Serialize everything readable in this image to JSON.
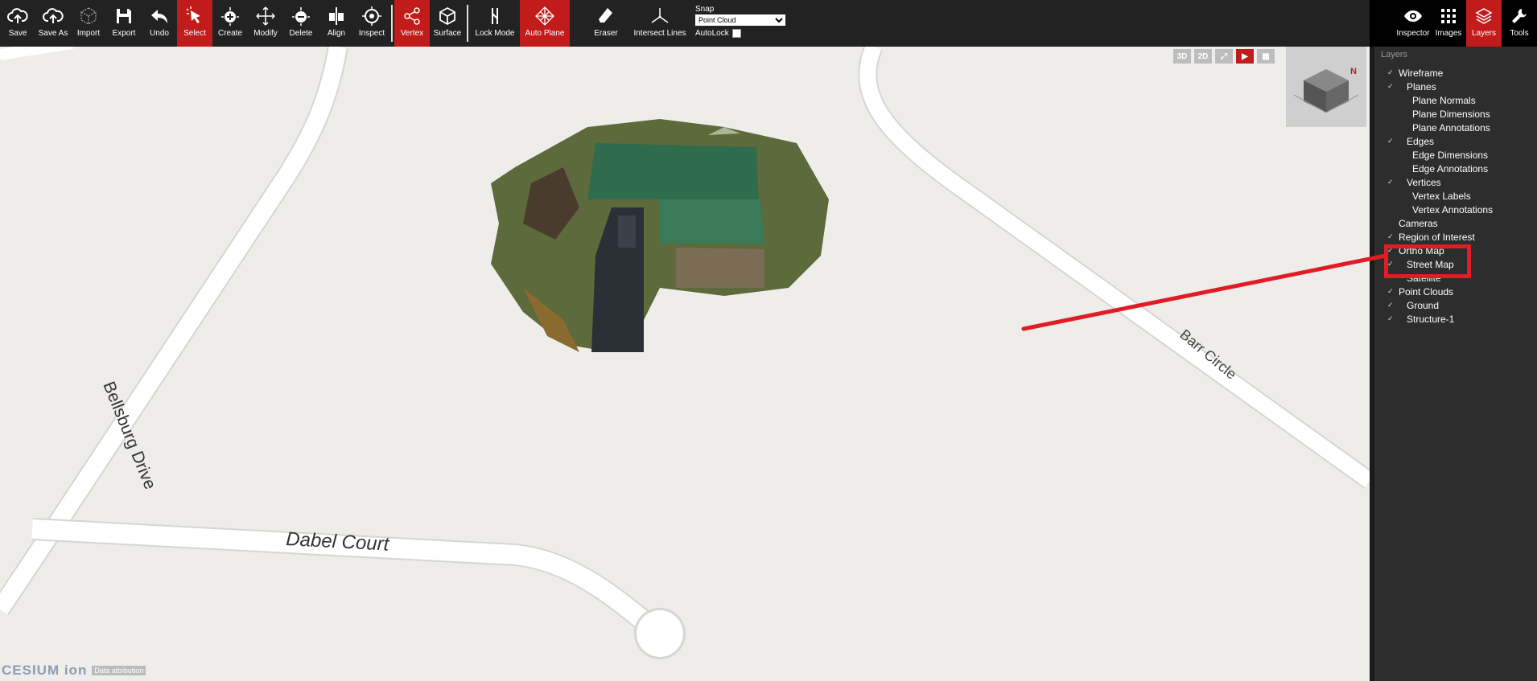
{
  "toolbar": {
    "buttons": [
      {
        "label": "Save",
        "icon": "cloud-upload-icon"
      },
      {
        "label": "Save As",
        "icon": "cloud-upload-icon"
      },
      {
        "label": "Import",
        "icon": "cube-outline-icon"
      },
      {
        "label": "Export",
        "icon": "floppy-icon"
      },
      {
        "label": "Undo",
        "icon": "undo-arrow-icon"
      },
      {
        "label": "Select",
        "icon": "cursor-icon"
      },
      {
        "label": "Create",
        "icon": "plus-circle-icon"
      },
      {
        "label": "Modify",
        "icon": "move-arrows-icon"
      },
      {
        "label": "Delete",
        "icon": "minus-circle-icon"
      },
      {
        "label": "Align",
        "icon": "align-icon"
      },
      {
        "label": "Inspect",
        "icon": "target-icon"
      },
      {
        "label": "Vertex",
        "icon": "share-nodes-icon"
      },
      {
        "label": "Surface",
        "icon": "cube-icon"
      },
      {
        "label": "Lock Mode",
        "icon": "lock-mode-icon"
      },
      {
        "label": "Auto Plane",
        "icon": "grid-diamond-icon"
      },
      {
        "label": "Eraser",
        "icon": "eraser-icon"
      },
      {
        "label": "Intersect Lines",
        "icon": "intersect-lines-icon"
      }
    ],
    "snap": {
      "label": "Snap",
      "selected": "Point Cloud",
      "autolock_label": "AutoLock"
    }
  },
  "right_tabs": [
    {
      "label": "Inspector",
      "icon": "eye-icon"
    },
    {
      "label": "Images",
      "icon": "grid-icon"
    },
    {
      "label": "Layers",
      "icon": "layers-icon"
    },
    {
      "label": "Tools",
      "icon": "wrench-icon"
    }
  ],
  "view_buttons": [
    "3D",
    "2D"
  ],
  "map": {
    "roads": [
      "Bellsburg Drive",
      "Dabel Court",
      "Barr Circle"
    ],
    "cesium_logo": "CESIUM ion",
    "attribution": "Data attribution"
  },
  "layers_panel": {
    "title": "Layers",
    "items": [
      {
        "label": "Wireframe",
        "checked": true,
        "level": 0
      },
      {
        "label": "Planes",
        "checked": true,
        "level": 1
      },
      {
        "label": "Plane Normals",
        "checked": false,
        "level": 2
      },
      {
        "label": "Plane Dimensions",
        "checked": false,
        "level": 2
      },
      {
        "label": "Plane Annotations",
        "checked": false,
        "level": 2
      },
      {
        "label": "Edges",
        "checked": true,
        "level": 1
      },
      {
        "label": "Edge Dimensions",
        "checked": false,
        "level": 2
      },
      {
        "label": "Edge Annotations",
        "checked": false,
        "level": 2
      },
      {
        "label": "Vertices",
        "checked": true,
        "level": 1
      },
      {
        "label": "Vertex Labels",
        "checked": false,
        "level": 2
      },
      {
        "label": "Vertex Annotations",
        "checked": false,
        "level": 2
      },
      {
        "label": "Cameras",
        "checked": false,
        "level": 0
      },
      {
        "label": "Region of Interest",
        "checked": true,
        "level": 0
      },
      {
        "label": "Ortho Map",
        "checked": true,
        "level": 0
      },
      {
        "label": "Street Map",
        "checked": true,
        "level": 1
      },
      {
        "label": "Satellite",
        "checked": false,
        "level": 1
      },
      {
        "label": "Point Clouds",
        "checked": true,
        "level": 0
      },
      {
        "label": "Ground",
        "checked": true,
        "level": 1
      },
      {
        "label": "Structure-1",
        "checked": true,
        "level": 1
      }
    ]
  },
  "colors": {
    "accent": "#c11b1b",
    "annotation": "#e01c24"
  }
}
